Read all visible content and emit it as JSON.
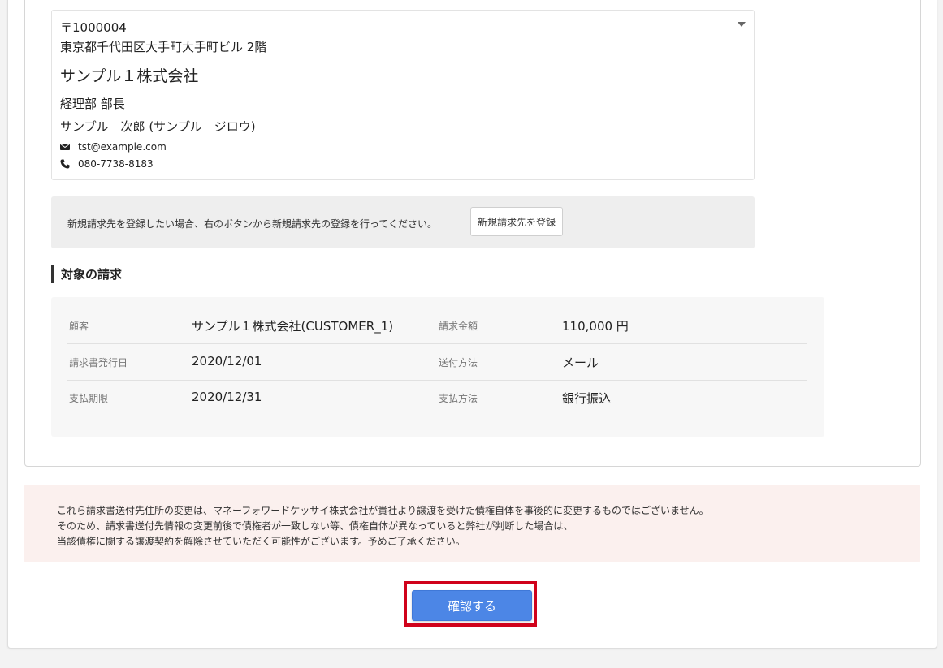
{
  "address": {
    "postal": "〒1000004",
    "line1": "東京都千代田区大手町大手町ビル 2階",
    "company": "サンプル１株式会社",
    "department": "経理部 部長",
    "person": "サンプル　次郎 (サンプル　ジロウ)",
    "email": "tst@example.com",
    "phone": "080-7738-8183",
    "email_icon": "envelope-icon",
    "phone_icon": "phone-icon"
  },
  "register": {
    "text": "新規請求先を登録したい場合、右のボタンから新規請求先の登録を行ってください。",
    "button_label": "新規請求先を登録"
  },
  "invoice": {
    "heading": "対象の請求",
    "rows": [
      {
        "label1": "顧客",
        "value1": "サンプル１株式会社(CUSTOMER_1)",
        "label2": "請求金額",
        "value2": "110,000 円"
      },
      {
        "label1": "請求書発行日",
        "value1": "2020/12/01",
        "label2": "送付方法",
        "value2": "メール"
      },
      {
        "label1": "支払期限",
        "value1": "2020/12/31",
        "label2": "支払方法",
        "value2": "銀行振込"
      }
    ]
  },
  "notice": {
    "line1": "これら請求書送付先住所の変更は、マネーフォワードケッサイ株式会社が貴社より譲渡を受けた債権自体を事後的に変更するものではございません。",
    "line2": "そのため、請求書送付先情報の変更前後で債権者が一致しない等、債権自体が異なっていると弊社が判断した場合は、",
    "line3": "当該債権に関する譲渡契約を解除させていただく可能性がございます。予めご了承ください。"
  },
  "confirm": {
    "label": "確認する",
    "highlight_color": "#d0021b",
    "button_color": "#4c86e6"
  }
}
